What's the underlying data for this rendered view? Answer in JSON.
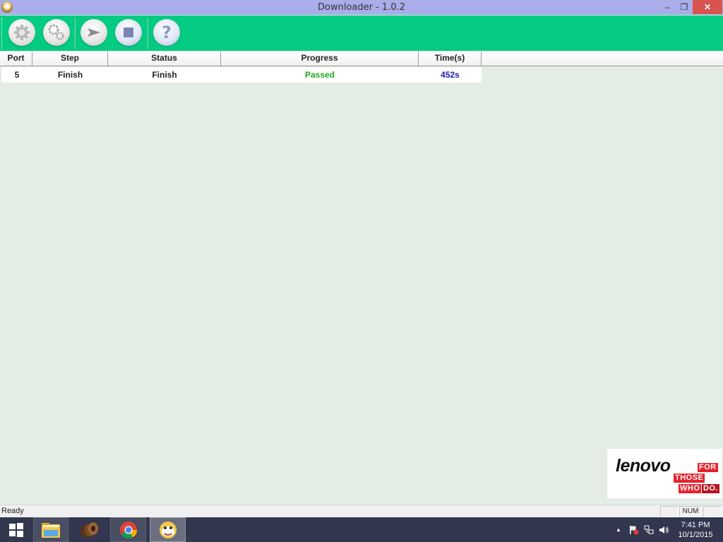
{
  "window": {
    "title": "Downloader - 1.0.2",
    "minimize_glyph": "–",
    "restore_glyph": "❐",
    "close_glyph": "✕"
  },
  "toolbar": {
    "buttons": [
      {
        "name": "settings",
        "icon": "gear-icon"
      },
      {
        "name": "advanced-settings",
        "icon": "gears-icon"
      },
      {
        "name": "start",
        "icon": "play-arrow-icon"
      },
      {
        "name": "stop",
        "icon": "stop-square-icon"
      },
      {
        "name": "help",
        "icon": "question-icon",
        "glyph": "?"
      }
    ]
  },
  "table": {
    "columns": [
      "Port",
      "Step",
      "Status",
      "Progress",
      "Time(s)"
    ],
    "rows": [
      {
        "port": "5",
        "step": "Finish",
        "status": "Finish",
        "progress": "Passed",
        "time": "452s"
      }
    ],
    "colors": {
      "progress_passed": "#1fa81f",
      "time": "#1a1ab8"
    }
  },
  "logo": {
    "brand": "lenovo",
    "tagline": [
      "FOR",
      "THOSE",
      "WHO",
      "DO."
    ]
  },
  "statusbar": {
    "text": "Ready",
    "panes": [
      "",
      "NUM",
      ""
    ]
  },
  "taskbar": {
    "items": [
      "start-button",
      "file-explorer",
      "app-brown",
      "chrome",
      "downloader-app"
    ],
    "tray": {
      "show_hidden_glyph": "▲",
      "time": "7:41 PM",
      "date": "10/1/2015"
    }
  }
}
